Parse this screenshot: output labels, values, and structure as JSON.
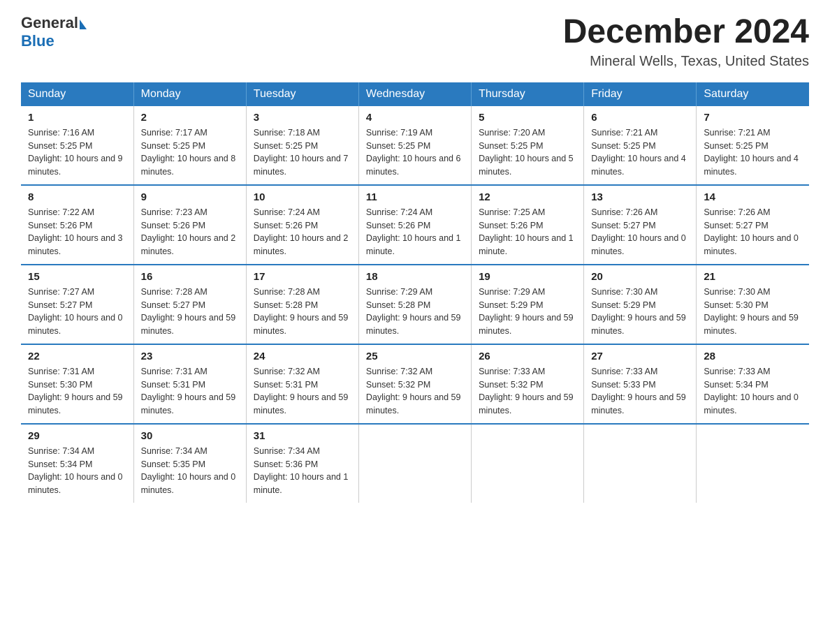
{
  "header": {
    "logo_general": "General",
    "logo_blue": "Blue",
    "month_title": "December 2024",
    "location": "Mineral Wells, Texas, United States"
  },
  "days_of_week": [
    "Sunday",
    "Monday",
    "Tuesday",
    "Wednesday",
    "Thursday",
    "Friday",
    "Saturday"
  ],
  "weeks": [
    [
      {
        "day": "1",
        "sunrise": "7:16 AM",
        "sunset": "5:25 PM",
        "daylight": "10 hours and 9 minutes."
      },
      {
        "day": "2",
        "sunrise": "7:17 AM",
        "sunset": "5:25 PM",
        "daylight": "10 hours and 8 minutes."
      },
      {
        "day": "3",
        "sunrise": "7:18 AM",
        "sunset": "5:25 PM",
        "daylight": "10 hours and 7 minutes."
      },
      {
        "day": "4",
        "sunrise": "7:19 AM",
        "sunset": "5:25 PM",
        "daylight": "10 hours and 6 minutes."
      },
      {
        "day": "5",
        "sunrise": "7:20 AM",
        "sunset": "5:25 PM",
        "daylight": "10 hours and 5 minutes."
      },
      {
        "day": "6",
        "sunrise": "7:21 AM",
        "sunset": "5:25 PM",
        "daylight": "10 hours and 4 minutes."
      },
      {
        "day": "7",
        "sunrise": "7:21 AM",
        "sunset": "5:25 PM",
        "daylight": "10 hours and 4 minutes."
      }
    ],
    [
      {
        "day": "8",
        "sunrise": "7:22 AM",
        "sunset": "5:26 PM",
        "daylight": "10 hours and 3 minutes."
      },
      {
        "day": "9",
        "sunrise": "7:23 AM",
        "sunset": "5:26 PM",
        "daylight": "10 hours and 2 minutes."
      },
      {
        "day": "10",
        "sunrise": "7:24 AM",
        "sunset": "5:26 PM",
        "daylight": "10 hours and 2 minutes."
      },
      {
        "day": "11",
        "sunrise": "7:24 AM",
        "sunset": "5:26 PM",
        "daylight": "10 hours and 1 minute."
      },
      {
        "day": "12",
        "sunrise": "7:25 AM",
        "sunset": "5:26 PM",
        "daylight": "10 hours and 1 minute."
      },
      {
        "day": "13",
        "sunrise": "7:26 AM",
        "sunset": "5:27 PM",
        "daylight": "10 hours and 0 minutes."
      },
      {
        "day": "14",
        "sunrise": "7:26 AM",
        "sunset": "5:27 PM",
        "daylight": "10 hours and 0 minutes."
      }
    ],
    [
      {
        "day": "15",
        "sunrise": "7:27 AM",
        "sunset": "5:27 PM",
        "daylight": "10 hours and 0 minutes."
      },
      {
        "day": "16",
        "sunrise": "7:28 AM",
        "sunset": "5:27 PM",
        "daylight": "9 hours and 59 minutes."
      },
      {
        "day": "17",
        "sunrise": "7:28 AM",
        "sunset": "5:28 PM",
        "daylight": "9 hours and 59 minutes."
      },
      {
        "day": "18",
        "sunrise": "7:29 AM",
        "sunset": "5:28 PM",
        "daylight": "9 hours and 59 minutes."
      },
      {
        "day": "19",
        "sunrise": "7:29 AM",
        "sunset": "5:29 PM",
        "daylight": "9 hours and 59 minutes."
      },
      {
        "day": "20",
        "sunrise": "7:30 AM",
        "sunset": "5:29 PM",
        "daylight": "9 hours and 59 minutes."
      },
      {
        "day": "21",
        "sunrise": "7:30 AM",
        "sunset": "5:30 PM",
        "daylight": "9 hours and 59 minutes."
      }
    ],
    [
      {
        "day": "22",
        "sunrise": "7:31 AM",
        "sunset": "5:30 PM",
        "daylight": "9 hours and 59 minutes."
      },
      {
        "day": "23",
        "sunrise": "7:31 AM",
        "sunset": "5:31 PM",
        "daylight": "9 hours and 59 minutes."
      },
      {
        "day": "24",
        "sunrise": "7:32 AM",
        "sunset": "5:31 PM",
        "daylight": "9 hours and 59 minutes."
      },
      {
        "day": "25",
        "sunrise": "7:32 AM",
        "sunset": "5:32 PM",
        "daylight": "9 hours and 59 minutes."
      },
      {
        "day": "26",
        "sunrise": "7:33 AM",
        "sunset": "5:32 PM",
        "daylight": "9 hours and 59 minutes."
      },
      {
        "day": "27",
        "sunrise": "7:33 AM",
        "sunset": "5:33 PM",
        "daylight": "9 hours and 59 minutes."
      },
      {
        "day": "28",
        "sunrise": "7:33 AM",
        "sunset": "5:34 PM",
        "daylight": "10 hours and 0 minutes."
      }
    ],
    [
      {
        "day": "29",
        "sunrise": "7:34 AM",
        "sunset": "5:34 PM",
        "daylight": "10 hours and 0 minutes."
      },
      {
        "day": "30",
        "sunrise": "7:34 AM",
        "sunset": "5:35 PM",
        "daylight": "10 hours and 0 minutes."
      },
      {
        "day": "31",
        "sunrise": "7:34 AM",
        "sunset": "5:36 PM",
        "daylight": "10 hours and 1 minute."
      },
      null,
      null,
      null,
      null
    ]
  ],
  "labels": {
    "sunrise": "Sunrise:",
    "sunset": "Sunset:",
    "daylight": "Daylight:"
  }
}
